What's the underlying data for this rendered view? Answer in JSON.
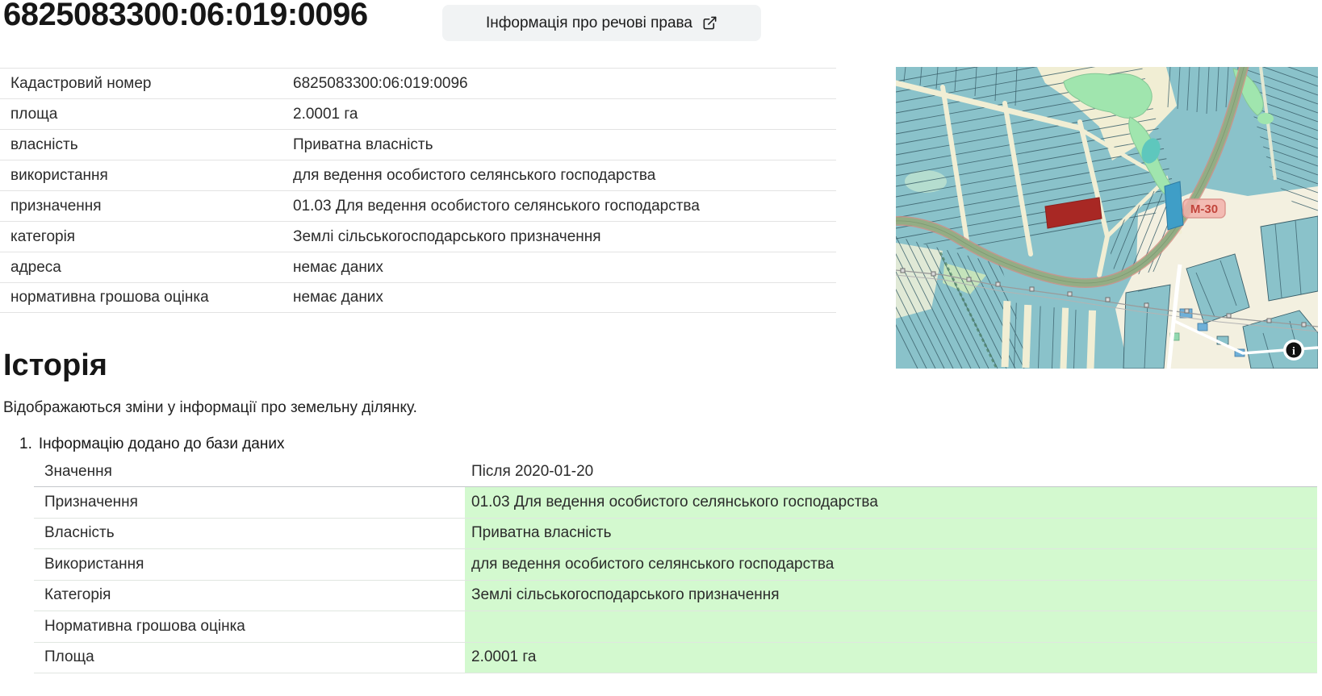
{
  "page": {
    "title": "6825083300:06:019:0096",
    "rights_button_label": "Інформація про речові права"
  },
  "details_table": {
    "rows": [
      {
        "label": "Кадастровий номер",
        "value": "6825083300:06:019:0096"
      },
      {
        "label": "площа",
        "value": "2.0001 га"
      },
      {
        "label": "власність",
        "value": "Приватна власність"
      },
      {
        "label": "використання",
        "value": "для ведення особистого селянського господарства"
      },
      {
        "label": "призначення",
        "value": "01.03 Для ведення особистого селянського господарства"
      },
      {
        "label": "категорія",
        "value": "Землі сільськогосподарського призначення"
      },
      {
        "label": "адреса",
        "value": "немає даних"
      },
      {
        "label": "нормативна грошова оцінка",
        "value": "немає даних"
      }
    ]
  },
  "map": {
    "road_label": "М-30",
    "info_glyph": "i",
    "highlight_color": "#a82824",
    "parcel_color": "#8ac2ca"
  },
  "history": {
    "heading": "Історія",
    "description": "Відображаються зміни у інформації про земельну ділянку.",
    "item": {
      "index": "1.",
      "title": "Інформацію додано до бази даних",
      "table": {
        "header": {
          "label": "Значення",
          "value": "Після 2020-01-20"
        },
        "rows": [
          {
            "label": "Призначення",
            "value": "01.03 Для ведення особистого селянського господарства"
          },
          {
            "label": "Власність",
            "value": "Приватна власність"
          },
          {
            "label": "Використання",
            "value": "для ведення особистого селянського господарства"
          },
          {
            "label": "Категорія",
            "value": "Землі сільськогосподарського призначення"
          },
          {
            "label": "Нормативна грошова оцінка",
            "value": ""
          },
          {
            "label": "Площа",
            "value": "2.0001 га"
          }
        ]
      }
    }
  },
  "colors": {
    "row_highlight": "#d3f9cf",
    "button_bg": "#f1f3f4"
  }
}
